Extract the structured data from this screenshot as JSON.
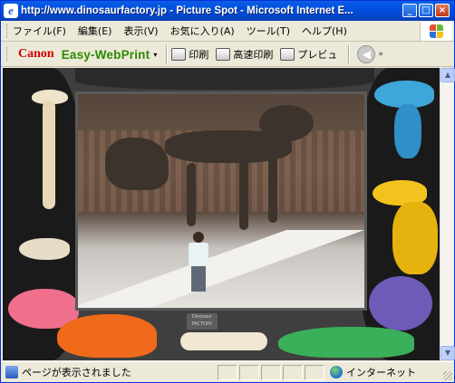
{
  "window": {
    "title": "http://www.dinosaurfactory.jp - Picture Spot - Microsoft Internet E...",
    "controls": {
      "minimize": "_",
      "maximize": "□",
      "close": "×"
    }
  },
  "menubar": {
    "items": [
      "ファイル(F)",
      "編集(E)",
      "表示(V)",
      "お気に入り(A)",
      "ツール(T)",
      "ヘルプ(H)"
    ]
  },
  "toolbar": {
    "brand": "Canon",
    "product": "Easy-WebPrint",
    "dropdown": "▾",
    "print": "印刷",
    "fast_print": "高速印刷",
    "preview": "プレビュ",
    "back_arrow": "◀",
    "more": "»"
  },
  "page": {
    "badge": "Dinosaur FACTORY"
  },
  "statusbar": {
    "text": "ページが表示されました",
    "zone": "インターネット"
  },
  "icons": {
    "ie": "internet-explorer-icon",
    "windows_logo": "windows-flag-icon",
    "printer": "printer-icon",
    "zone": "globe-icon"
  },
  "colors": {
    "titlebar": "#0050e0",
    "canon_red": "#d10000",
    "easywebprint_green": "#2d8a00"
  }
}
